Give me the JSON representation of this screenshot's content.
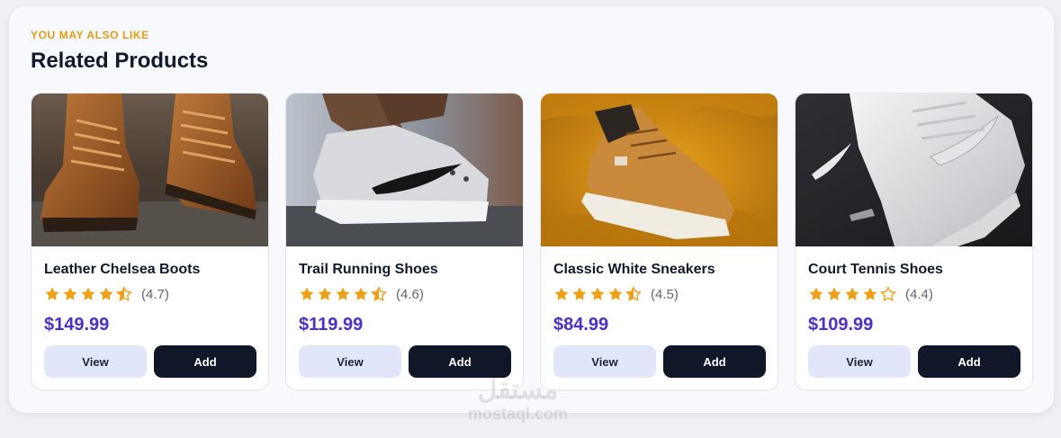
{
  "section": {
    "eyebrow": "YOU MAY ALSO LIKE",
    "title": "Related Products"
  },
  "products": [
    {
      "name": "Leather Chelsea Boots",
      "rating": 4.7,
      "rating_text": "(4.7)",
      "price": "$149.99",
      "view_label": "View",
      "add_label": "Add",
      "image_icon": "leather-boots-photo"
    },
    {
      "name": "Trail Running Shoes",
      "rating": 4.6,
      "rating_text": "(4.6)",
      "price": "$119.99",
      "view_label": "View",
      "add_label": "Add",
      "image_icon": "running-shoe-photo"
    },
    {
      "name": "Classic White Sneakers",
      "rating": 4.5,
      "rating_text": "(4.5)",
      "price": "$84.99",
      "view_label": "View",
      "add_label": "Add",
      "image_icon": "tan-sneaker-photo"
    },
    {
      "name": "Court Tennis Shoes",
      "rating": 4.4,
      "rating_text": "(4.4)",
      "price": "$109.99",
      "view_label": "View",
      "add_label": "Add",
      "image_icon": "white-sneaker-photo"
    }
  ],
  "watermark": {
    "arabic": "مستقل",
    "latin": "mostaql.com"
  },
  "colors": {
    "eyebrow": "#e49b12",
    "title": "#111a2c",
    "price": "#4b2fc9",
    "star": "#f0a017",
    "view_button_bg": "#e2e6fb",
    "add_button_bg": "#0f1729"
  }
}
